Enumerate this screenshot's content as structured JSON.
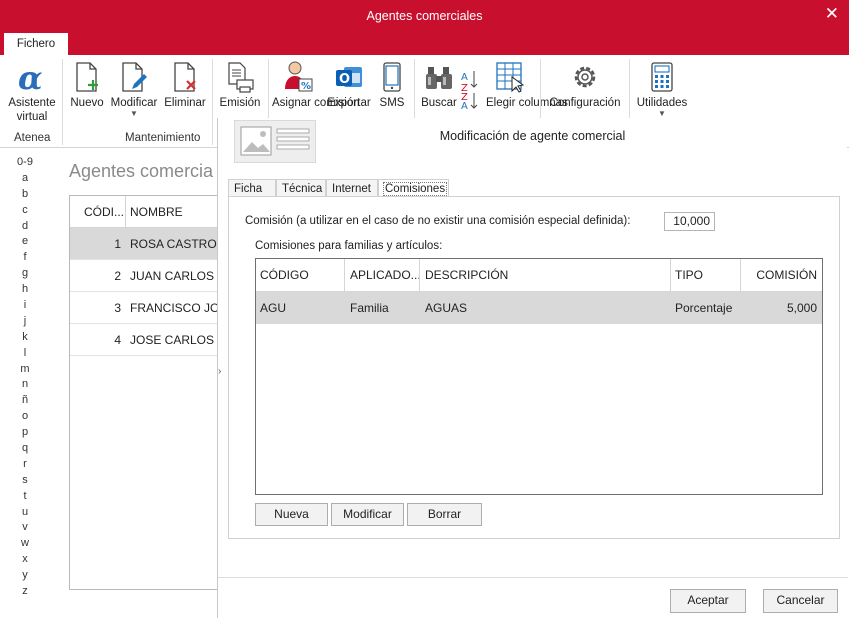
{
  "window": {
    "title": "Agentes comerciales",
    "close_glyph": "✕"
  },
  "menu": {
    "tab": "Fichero"
  },
  "ribbon": {
    "asistente": "Asistente virtual",
    "atenea_label": "Atenea",
    "nuevo": "Nuevo",
    "modificar": "Modificar",
    "eliminar": "Eliminar",
    "mantenimiento_label": "Mantenimiento",
    "emision": "Emisión",
    "asignar": "Asignar comisión",
    "exportar": "Exportar",
    "sms": "SMS",
    "buscar": "Buscar",
    "elegir": "Elegir columnas",
    "configuracion": "Configuración",
    "utilidades": "Utilidades"
  },
  "alphabet": [
    "0-9",
    "a",
    "b",
    "c",
    "d",
    "e",
    "f",
    "g",
    "h",
    "i",
    "j",
    "k",
    "l",
    "m",
    "n",
    "ñ",
    "o",
    "p",
    "q",
    "r",
    "s",
    "t",
    "u",
    "v",
    "w",
    "x",
    "y",
    "z"
  ],
  "list": {
    "title": "Agentes comercia",
    "headers": {
      "code": "CÓDI...",
      "name": "NOMBRE"
    },
    "rows": [
      {
        "code": "1",
        "name": "ROSA CASTRO PA"
      },
      {
        "code": "2",
        "name": "JUAN CARLOS RO"
      },
      {
        "code": "3",
        "name": "FRANCISCO JOSI"
      },
      {
        "code": "4",
        "name": "JOSE CARLOS RU"
      }
    ]
  },
  "panel": {
    "title": "Modificación de agente comercial",
    "tabs": [
      "Ficha",
      "Técnica",
      "Internet",
      "Comisiones"
    ],
    "commission_label": "Comisión (a utilizar en el caso de no existir una comisión especial definida):",
    "commission_value": "10,000",
    "families_label": "Comisiones para familias y artículos:",
    "grid": {
      "headers": {
        "codigo": "CÓDIGO",
        "aplicado": "APLICADO...",
        "descripcion": "DESCRIPCIÓN",
        "tipo": "TIPO",
        "comision": "COMISIÓN"
      },
      "rows": [
        {
          "codigo": "AGU",
          "aplicado": "Familia",
          "descripcion": "AGUAS",
          "tipo": "Porcentaje",
          "comision": "5,000"
        }
      ]
    },
    "buttons": {
      "nueva": "Nueva",
      "modificar": "Modificar",
      "borrar": "Borrar"
    },
    "footer": {
      "aceptar": "Aceptar",
      "cancelar": "Cancelar"
    }
  },
  "colors": {
    "brand": "#c8102e",
    "selected_row": "#d9d9d9",
    "accent_blue": "#1e73be",
    "accent_green": "#2e9d3a",
    "accent_red": "#d32f2f"
  },
  "icons": [
    "alpha-icon",
    "new-doc-icon",
    "edit-doc-icon",
    "delete-doc-icon",
    "print-icon",
    "assign-commission-icon",
    "outlook-icon",
    "phone-icon",
    "binoculars-icon",
    "sort-icon",
    "columns-icon",
    "gear-icon",
    "calculator-icon"
  ]
}
